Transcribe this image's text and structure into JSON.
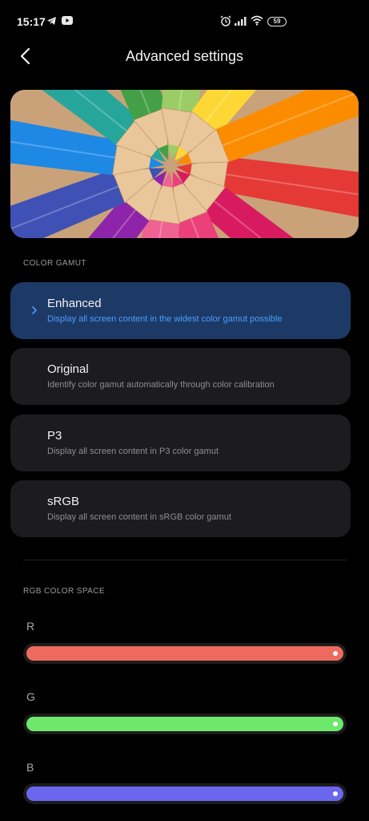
{
  "status_bar": {
    "time": "15:17",
    "battery": "59",
    "left_icons": [
      "telegram-icon",
      "youtube-icon"
    ],
    "right_icons": [
      "alarm-icon",
      "signal-icon",
      "wifi-icon",
      "battery-icon"
    ]
  },
  "header": {
    "title": "Advanced settings",
    "back_icon": "back-arrow-icon"
  },
  "hero": {
    "subject": "colored-pencils-image",
    "colors": [
      "#e53935",
      "#d81b60",
      "#ec407a",
      "#f06292",
      "#8e24aa",
      "#3f51b5",
      "#1e88e5",
      "#26a69a",
      "#43a047",
      "#9ccc65",
      "#fdd835",
      "#fb8c00"
    ]
  },
  "color_gamut": {
    "label": "COLOR GAMUT",
    "options": [
      {
        "title": "Enhanced",
        "description": "Display all screen content in the widest color gamut possible",
        "selected": true
      },
      {
        "title": "Original",
        "description": "Identify color gamut automatically through color calibration",
        "selected": false
      },
      {
        "title": "P3",
        "description": "Display all screen content in P3 color gamut",
        "selected": false
      },
      {
        "title": "sRGB",
        "description": "Display all screen content in sRGB color gamut",
        "selected": false
      }
    ]
  },
  "rgb": {
    "label": "RGB COLOR SPACE",
    "channels": [
      {
        "label": "R",
        "value": 1.0,
        "color": "#ee6a5f"
      },
      {
        "label": "G",
        "value": 1.0,
        "color": "#6ee86b"
      },
      {
        "label": "B",
        "value": 1.0,
        "color": "#6b66ee"
      }
    ]
  },
  "colors": {
    "background": "#000000",
    "card": "#1c1c1e",
    "selected_card": "#1d3a66",
    "accent": "#4b9dff"
  }
}
